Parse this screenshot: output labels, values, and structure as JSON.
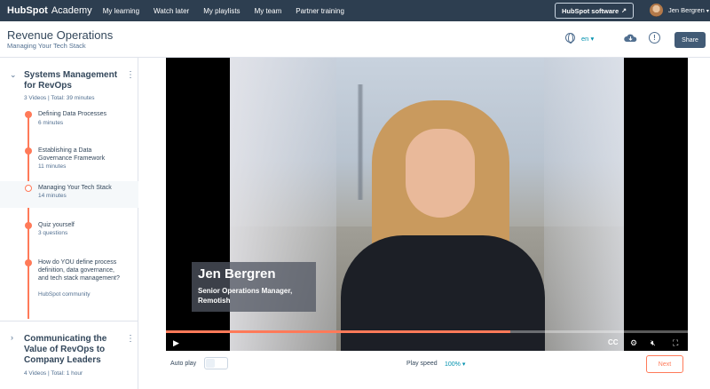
{
  "topnav": {
    "brand": "HubSpot",
    "brand_suffix": "Academy",
    "items": [
      "My learning",
      "Watch later",
      "My playlists",
      "My team",
      "Partner training"
    ],
    "software_button": "HubSpot software",
    "user_name": "Jen Bergren"
  },
  "header": {
    "title": "Revenue Operations",
    "subtitle": "Managing Your Tech Stack",
    "language": "en"
  },
  "header_actions": {
    "share": "Share",
    "icons": [
      "globe-icon",
      "cloud-download-icon",
      "info-icon"
    ]
  },
  "sidebar": {
    "section1": {
      "title": "Systems Management for RevOps",
      "meta": "3 Videos | Total: 39 minutes"
    },
    "lessons": [
      {
        "title": "Defining Data Processes",
        "meta": "6 minutes"
      },
      {
        "title": "Establishing a Data Governance Framework",
        "meta": "11 minutes"
      },
      {
        "title": "Managing Your Tech Stack",
        "meta": "14 minutes"
      },
      {
        "title": "Quiz yourself",
        "meta": "3 questions"
      },
      {
        "title": "How do YOU define process definition, data governance, and tech stack management?",
        "meta": "HubSpot community"
      }
    ],
    "section2": {
      "title": "Communicating the Value of RevOps to Company Leaders",
      "meta": "4 Videos | Total: 1 hour"
    }
  },
  "video": {
    "lower_third_name": "Jen Bergren",
    "lower_third_role": "Senior Operations Manager, Remotish",
    "progress_fraction": 0.66,
    "controls": [
      "play-icon",
      "closed-captions-icon",
      "settings-hd-icon",
      "mute-icon",
      "fullscreen-icon"
    ],
    "cc_label": "CC",
    "accent_color": "#ff7a59"
  },
  "below_video": {
    "autoplay_label": "Auto play",
    "play_speed_label": "Play speed",
    "play_speed_value": "100%",
    "next_label": "Next"
  }
}
